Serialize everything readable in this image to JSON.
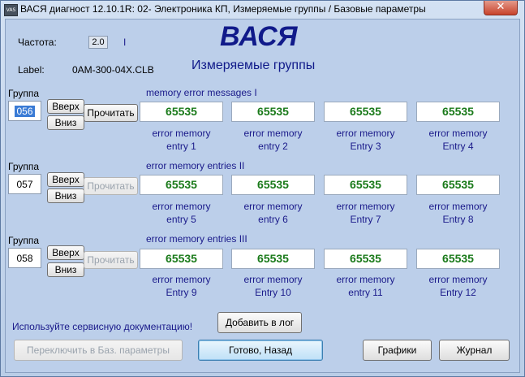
{
  "window": {
    "title": "ВАСЯ диагност 12.10.1R: 02- Электроника КП,  Измеряемые группы / Базовые параметры",
    "close_glyph": "✕",
    "icon_text": "VAS"
  },
  "header": {
    "freq_label": "Частота:",
    "freq_value": "2.0",
    "freq_marker": "I",
    "label_label": "Label:",
    "label_value": "0AM-300-04X.CLB",
    "app_name": "ВАСЯ",
    "screen_title": "Измеряемые группы"
  },
  "groups": [
    {
      "label": "Группа",
      "number": "056",
      "title": "memory error messages I",
      "up": "Вверх",
      "down": "Вниз",
      "read": "Прочитать",
      "values": [
        "65535",
        "65535",
        "65535",
        "65535"
      ],
      "captions": [
        [
          "error memory",
          "entry 1"
        ],
        [
          "error memory",
          "entry 2"
        ],
        [
          "error memory",
          "Entry 3"
        ],
        [
          "error memory",
          "Entry 4"
        ]
      ]
    },
    {
      "label": "Группа",
      "number": "057",
      "title": "error memory entries II",
      "up": "Вверх",
      "down": "Вниз",
      "read": "Прочитать",
      "values": [
        "65535",
        "65535",
        "65535",
        "65535"
      ],
      "captions": [
        [
          "error memory",
          "entry 5"
        ],
        [
          "error memory",
          "entry 6"
        ],
        [
          "error memory",
          "Entry 7"
        ],
        [
          "error memory",
          "Entry 8"
        ]
      ]
    },
    {
      "label": "Группа",
      "number": "058",
      "title": "error memory entries III",
      "up": "Вверх",
      "down": "Вниз",
      "read": "Прочитать",
      "values": [
        "65535",
        "65535",
        "65535",
        "65535"
      ],
      "captions": [
        [
          "error memory",
          "Entry 9"
        ],
        [
          "error memory",
          "Entry 10"
        ],
        [
          "error memory",
          "entry 11"
        ],
        [
          "error memory",
          "Entry 12"
        ]
      ]
    }
  ],
  "footer": {
    "hint": "Используйте сервисную документацию!",
    "add_log": "Добавить в лог",
    "switch_basic": "Переключить в Баз. параметры",
    "done_back": "Готово, Назад",
    "graphs": "Графики",
    "journal": "Журнал"
  }
}
